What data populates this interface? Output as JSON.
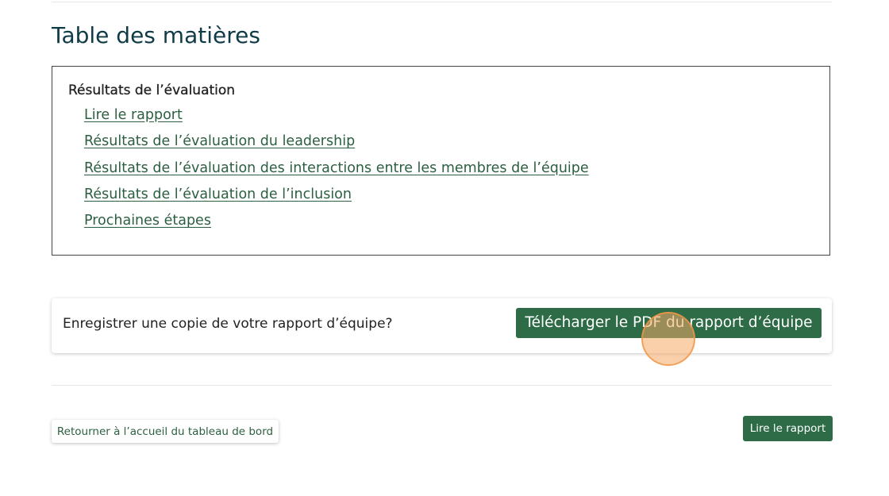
{
  "toc": {
    "title": "Table des matières",
    "section_heading": "Résultats de l’évaluation",
    "links": [
      "Lire le rapport",
      "Résultats de l’évaluation du leadership",
      "Résultats de l’évaluation des interactions entre les membres de l’équipe",
      "Résultats de l’évaluation de l’inclusion",
      "Prochaines étapes"
    ]
  },
  "save_card": {
    "prompt": "Enregistrer une copie de votre rapport d’équipe?",
    "download_label": "Télécharger le PDF du rapport d’équipe"
  },
  "footer_nav": {
    "back_label": "Retourner à l’accueil du tableau de bord",
    "next_label": "Lire le rapport"
  },
  "colors": {
    "accent_green": "#2e6b47",
    "link_green": "#2b5f3f",
    "title_teal": "#0f3b47"
  }
}
